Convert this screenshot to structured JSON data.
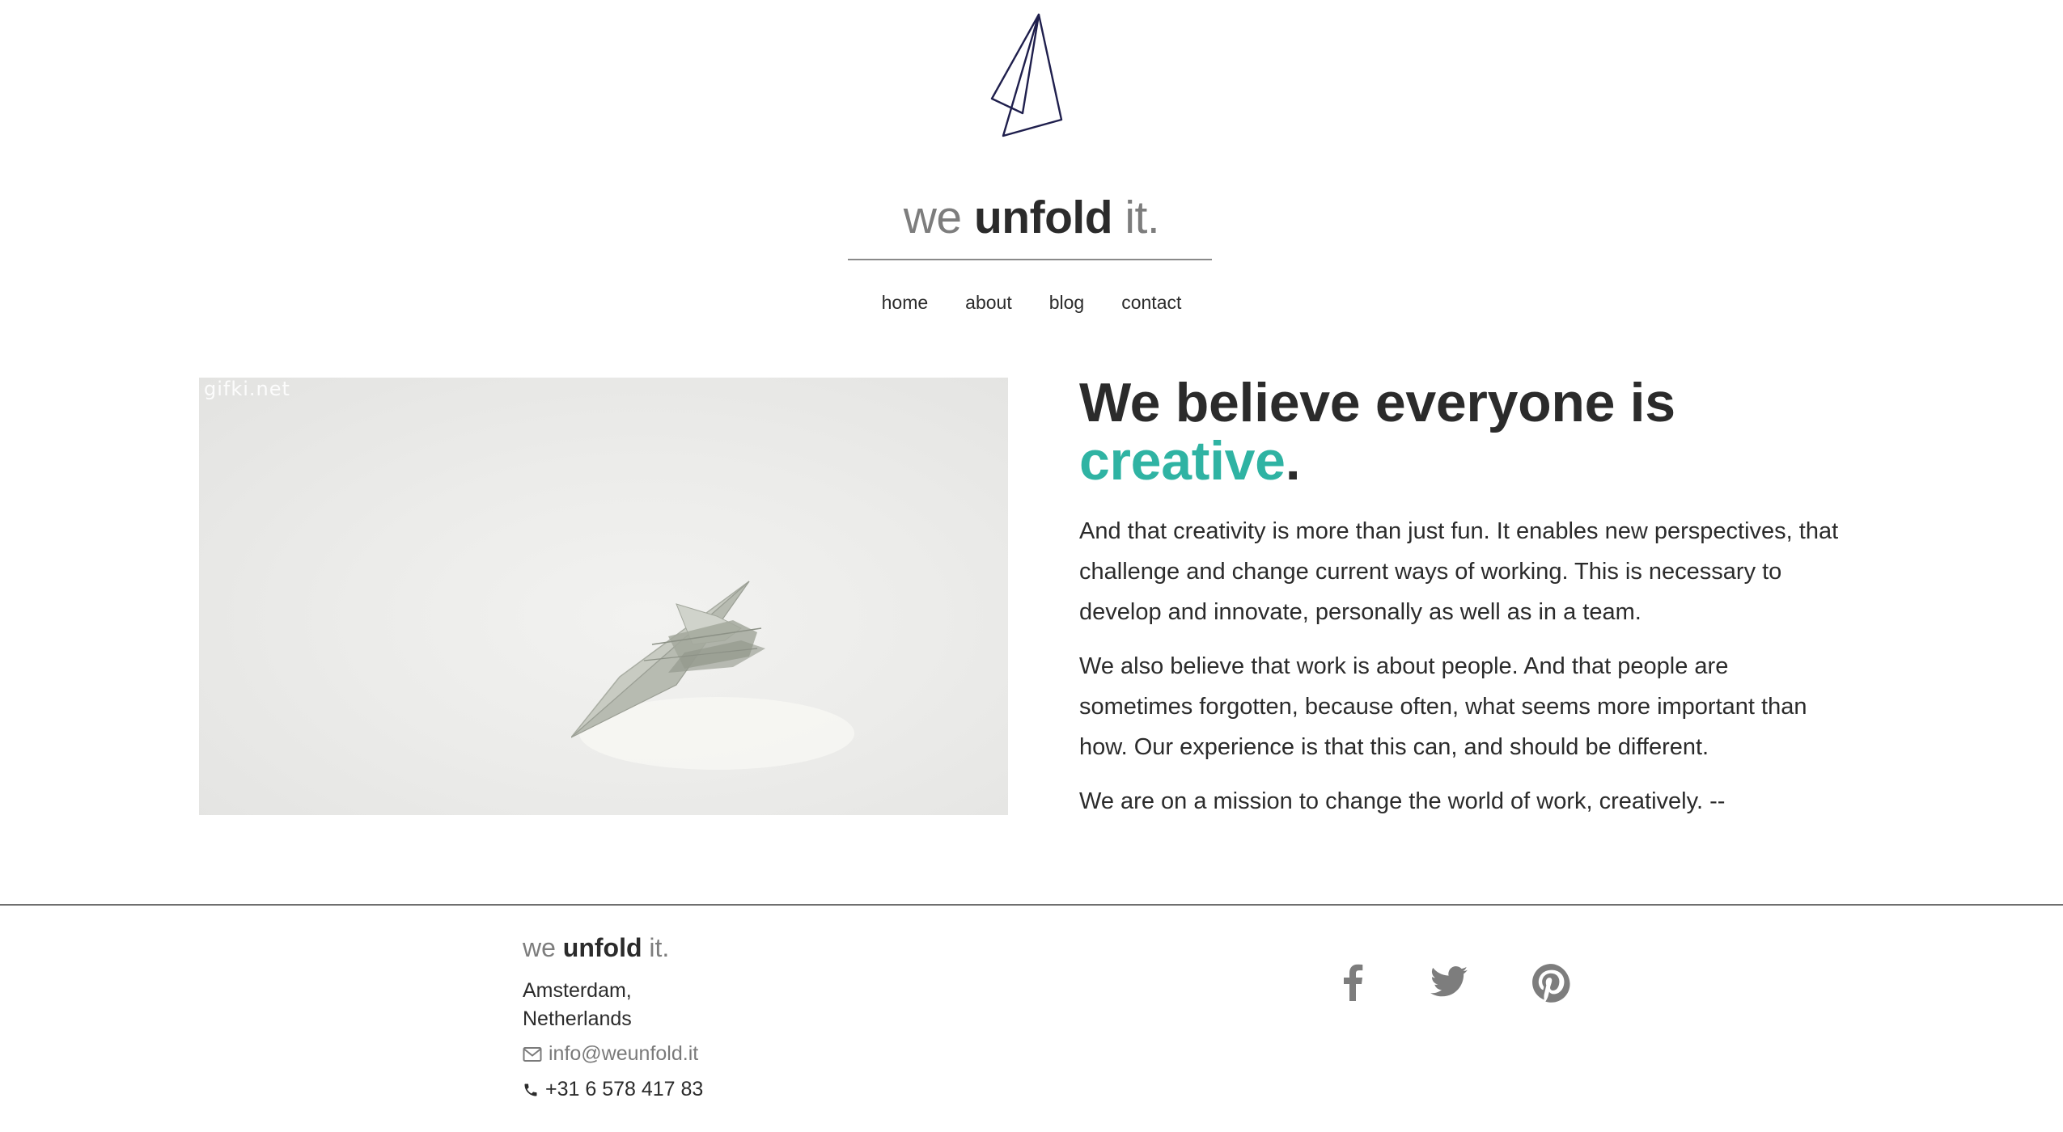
{
  "header": {
    "brand_prefix": "we ",
    "brand_main": "unfold",
    "brand_suffix": " it.",
    "nav": [
      {
        "label": "home"
      },
      {
        "label": "about"
      },
      {
        "label": "blog"
      },
      {
        "label": "contact"
      }
    ]
  },
  "hero": {
    "image_watermark": "gifki.net",
    "headline_line1": "We believe everyone is",
    "headline_accent": "creative",
    "headline_end": ".",
    "paragraphs": [
      "And that creativity is more than just fun. It enables new perspectives, that challenge and change current ways of working. This is necessary to develop and innovate, personally as well as in a team.",
      "We also believe that work is about people. And that people are sometimes forgotten, because often, what seems more important than how. Our experience is that this can, and should be different.",
      "We are on a mission to change the world of work, creatively. --"
    ]
  },
  "footer": {
    "brand_prefix": "we ",
    "brand_main": "unfold",
    "brand_suffix": " it.",
    "city": "Amsterdam,",
    "country": "Netherlands",
    "email": "info@weunfold.it",
    "phone": "+31 6 578 417 83",
    "social_icons": [
      "facebook-icon",
      "twitter-icon",
      "pinterest-icon"
    ]
  },
  "colors": {
    "accent": "#2fb3a3",
    "text": "#2b2b2b",
    "muted": "#7d7d7d",
    "logo_stroke": "#1f1f4d"
  }
}
